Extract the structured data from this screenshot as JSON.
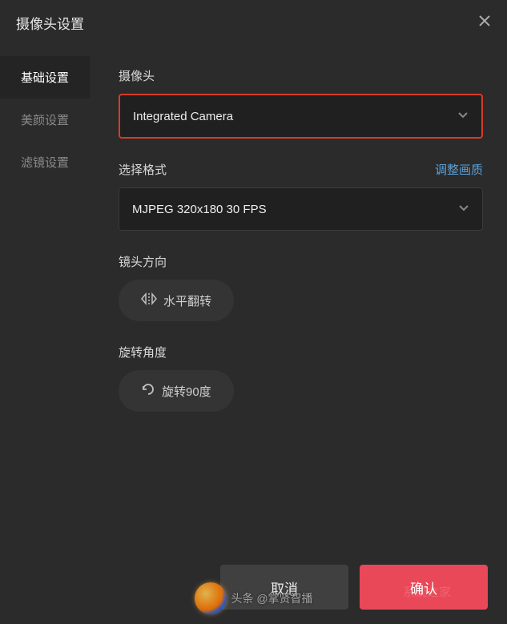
{
  "header": {
    "title": "摄像头设置"
  },
  "sidebar": {
    "items": [
      {
        "label": "基础设置",
        "active": true
      },
      {
        "label": "美颜设置",
        "active": false
      },
      {
        "label": "滤镜设置",
        "active": false
      }
    ]
  },
  "main": {
    "camera": {
      "label": "摄像头",
      "value": "Integrated Camera"
    },
    "format": {
      "label": "选择格式",
      "adjust_link": "调整画质",
      "value": "MJPEG 320x180 30 FPS"
    },
    "direction": {
      "label": "镜头方向",
      "button": "水平翻转"
    },
    "rotation": {
      "label": "旋转角度",
      "button": "旋转90度"
    }
  },
  "footer": {
    "cancel": "取消",
    "confirm": "确认"
  },
  "watermark": {
    "text": "头条 @掌贤智播",
    "faint": "系统之家"
  }
}
